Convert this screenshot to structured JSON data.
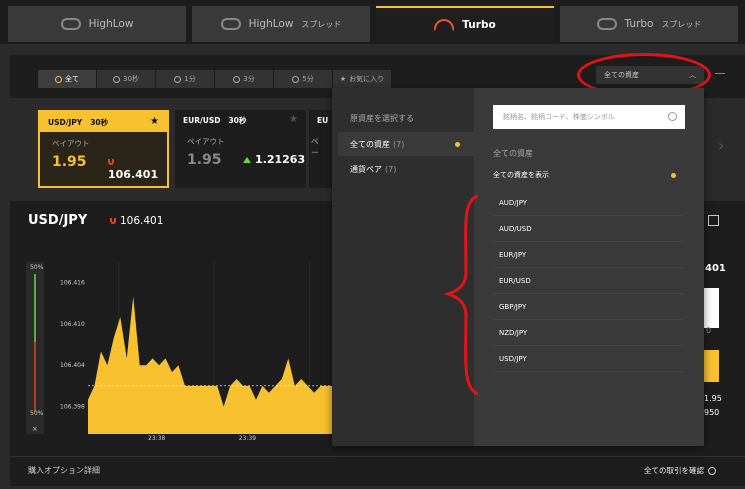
{
  "top_tabs": [
    {
      "label": "HighLow",
      "sub": ""
    },
    {
      "label": "HighLow",
      "sub": "スプレッド"
    },
    {
      "label": "Turbo",
      "sub": ""
    },
    {
      "label": "Turbo",
      "sub": "スプレッド"
    }
  ],
  "time_tabs": [
    "全て",
    "30秒",
    "1分",
    "3分",
    "5分",
    "お気に入り"
  ],
  "asset_select": {
    "label": "全ての資産"
  },
  "cards": [
    {
      "pair": "USD/JPY",
      "time": "30秒",
      "payout_label": "ペイアウト",
      "payout": "1.95",
      "rate": "106.401"
    },
    {
      "pair": "EUR/USD",
      "time": "30秒",
      "payout_label": "ペイアウト",
      "payout": "1.95",
      "rate": "1.21263"
    },
    {
      "pair": "EU",
      "payout_label": "ペー"
    }
  ],
  "pair_bar": {
    "name": "USD/JPY",
    "rate": "106.401"
  },
  "chart": {
    "y_ticks": [
      "106.416",
      "106.410",
      "106.404",
      "106.398"
    ],
    "x_ticks": [
      "23:38",
      "23:39"
    ],
    "left_top": "50%",
    "left_bottom": "50%",
    "close": "×"
  },
  "chart_data": {
    "type": "area",
    "x": [
      0,
      1,
      2,
      3,
      4,
      5,
      6,
      7,
      8,
      9,
      10,
      11,
      12,
      13,
      14,
      15,
      16,
      17,
      18,
      19,
      20,
      21,
      22,
      23,
      24,
      25,
      26,
      27,
      28,
      29,
      30,
      31,
      32,
      33,
      34,
      35,
      36,
      37,
      38,
      39
    ],
    "y": [
      106.399,
      106.401,
      106.406,
      106.404,
      106.408,
      106.411,
      106.405,
      106.414,
      106.404,
      106.404,
      106.405,
      106.404,
      106.405,
      106.403,
      106.404,
      106.401,
      106.401,
      106.401,
      106.401,
      106.401,
      106.401,
      106.398,
      106.401,
      106.402,
      106.401,
      106.401,
      106.399,
      106.401,
      106.4,
      106.401,
      106.402,
      106.405,
      106.401,
      106.402,
      106.401,
      106.4,
      106.401,
      106.401,
      106.401,
      106.401
    ],
    "ylim": [
      106.394,
      106.419
    ],
    "reference_line": 106.401,
    "xlabel": "",
    "ylabel": ""
  },
  "right_snips": {
    "r1": "401",
    "r2": "1.95",
    "r3": "950",
    "r4": "0"
  },
  "bottom": {
    "left": "購入オプション詳細",
    "right": "全ての取引を確認"
  },
  "dropdown": {
    "title": "原資産を選択する",
    "categories": [
      {
        "label": "全ての資産",
        "count": "(7)"
      },
      {
        "label": "通貨ペア",
        "count": "(7)"
      }
    ],
    "search_placeholder": "銘柄名、銘柄コード、株価シンボル",
    "section": "全ての資産",
    "show_all": "全ての資産を表示",
    "items": [
      "AUD/JPY",
      "AUD/USD",
      "EUR/JPY",
      "EUR/USD",
      "GBP/JPY",
      "NZD/JPY",
      "USD/JPY"
    ]
  },
  "colors": {
    "accent": "#f7c12f",
    "annotation": "#e3131a",
    "down": "#e8401e",
    "up": "#6bd64b"
  }
}
